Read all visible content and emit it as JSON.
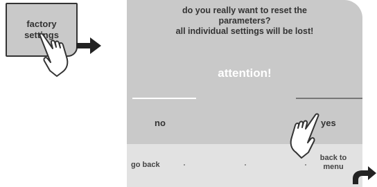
{
  "factory_button": {
    "line1": "factory",
    "line2": "settings"
  },
  "screen": {
    "warning_line1": "do you really want to reset the",
    "warning_line2": "parameters?",
    "warning_line3": "all individual settings will be lost!",
    "attention": "attention!",
    "option_no": "no",
    "option_yes": "yes",
    "bottom_bar": {
      "go_back": "go back",
      "back_to_menu_line1": "back to",
      "back_to_menu_line2": "menu"
    }
  },
  "icons": [
    "hand-pointer-icon",
    "arrow-right-icon",
    "curved-arrow-icon"
  ],
  "colors": {
    "screen_bg": "#c9c9c9",
    "bottom_bar_bg": "#e2e2e2",
    "text": "#333333",
    "attention": "#ffffff"
  }
}
